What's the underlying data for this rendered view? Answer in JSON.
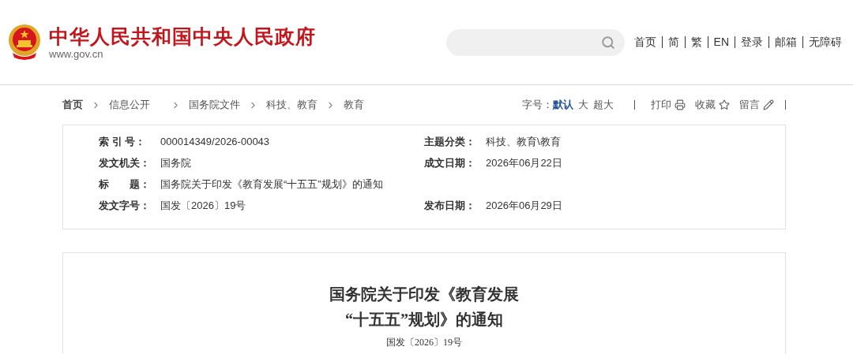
{
  "site": {
    "title": "中华人民共和国中央人民政府",
    "domain": "www.gov.cn"
  },
  "nav": [
    "首页",
    "简",
    "繁",
    "EN",
    "登录",
    "邮箱",
    "无障碍"
  ],
  "breadcrumb": [
    "首页",
    "信息公开",
    "国务院文件",
    "科技、教育",
    "教育"
  ],
  "font_size": {
    "label": "字号：",
    "options": [
      {
        "label": "默认",
        "selected": true
      },
      {
        "label": "大",
        "selected": false
      },
      {
        "label": "超大",
        "selected": false
      }
    ]
  },
  "tools": [
    {
      "label": "打印",
      "kind": "print"
    },
    {
      "label": "收藏",
      "kind": "favorite"
    },
    {
      "label": "留言",
      "kind": "comment"
    }
  ],
  "meta": {
    "rows": [
      {
        "cells": [
          {
            "label": "索 引 号：",
            "value": "000014349/2026-00043"
          },
          {
            "label": "主题分类：",
            "value": "科技、教育\\教育"
          }
        ]
      },
      {
        "cells": [
          {
            "label": "发文机关：",
            "value": "国务院"
          },
          {
            "label": "成文日期：",
            "value": "2026年06月22日"
          }
        ]
      },
      {
        "cells": [
          {
            "label": "标　　题：",
            "value": "国务院关于印发《教育发展“十五五”规划》的通知"
          }
        ]
      },
      {
        "cells": [
          {
            "label": "发文字号：",
            "value": "国发〔2026〕19号"
          },
          {
            "label": "发布日期：",
            "value": "2026年06月29日"
          }
        ]
      }
    ]
  },
  "document": {
    "title_lines": [
      "国务院关于印发《教育发展",
      "“十五五”规划》的通知"
    ],
    "number": "国发〔2026〕19号"
  }
}
